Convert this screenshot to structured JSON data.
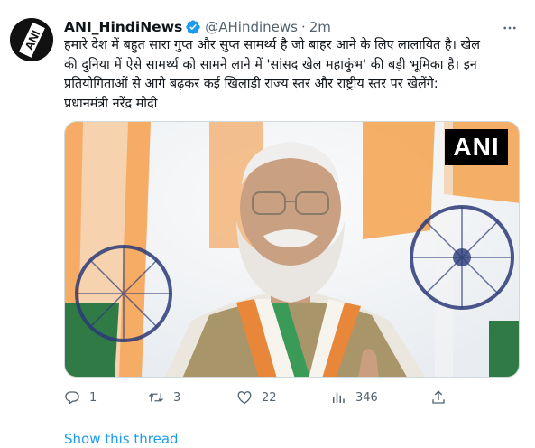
{
  "tweet": {
    "author": {
      "name": "ANI_HindiNews",
      "handle": "@AHindinews",
      "avatar_text": "ANI",
      "verified": true
    },
    "separator": "·",
    "timestamp": "2m",
    "text": "हमारे देश में बहुत सारा गुप्त और सुप्त सामर्थ्य है जो बाहर आने के लिए लालायित है। खेल\nकी दुनिया में ऐसे सामर्थ्य को सामने लाने में 'सांसद खेल महाकुंभ' की बड़ी भूमिका है। इन\nप्रतियोगिताओं से आगे बढ़कर कई खिलाड़ी राज्य स्तर और राष्ट्रीय स्तर पर खेलेंगे:\nप्रधानमंत्री नरेंद्र मोदी",
    "media": {
      "watermark": "ANI"
    },
    "actions": {
      "replies": "1",
      "retweets": "3",
      "likes": "22",
      "views": "346"
    },
    "show_thread_label": "Show this thread"
  },
  "colors": {
    "accent": "#1d9bf0",
    "text_primary": "#0f1419",
    "text_secondary": "#536471",
    "verified": "#1d9bf0"
  },
  "icons": {
    "reply": "reply-icon",
    "retweet": "retweet-icon",
    "like": "like-icon",
    "views": "views-icon",
    "share": "share-icon",
    "more": "more-icon",
    "verified": "verified-badge-icon"
  }
}
